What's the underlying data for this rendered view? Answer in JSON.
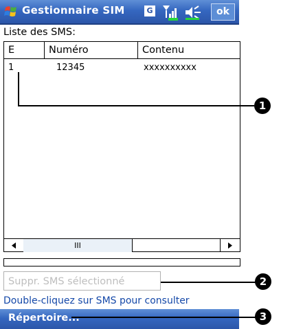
{
  "titlebar": {
    "title": "Gestionnaire SIM",
    "g_label": "G",
    "ok_label": "ok"
  },
  "list_label": "Liste des SMS:",
  "table": {
    "columns": [
      "E",
      "Numéro",
      "Contenu"
    ],
    "rows": [
      {
        "e": "1",
        "numero": "12345",
        "contenu": "xxxxxxxxxx"
      }
    ],
    "scroll_thumb": "III"
  },
  "delete_button": "Suppr. SMS sélectionné",
  "hint": "Double-cliquez sur SMS pour consulter",
  "menu": {
    "repertoire": "Répertoire..."
  },
  "callouts": [
    "1",
    "2",
    "3"
  ],
  "colors": {
    "titlebar": "#3567c0",
    "hint_text": "#1448a8",
    "disabled_text": "#bebebe"
  },
  "icons": [
    "windows-start-icon",
    "g-icon",
    "signal-icon",
    "speaker-icon"
  ]
}
